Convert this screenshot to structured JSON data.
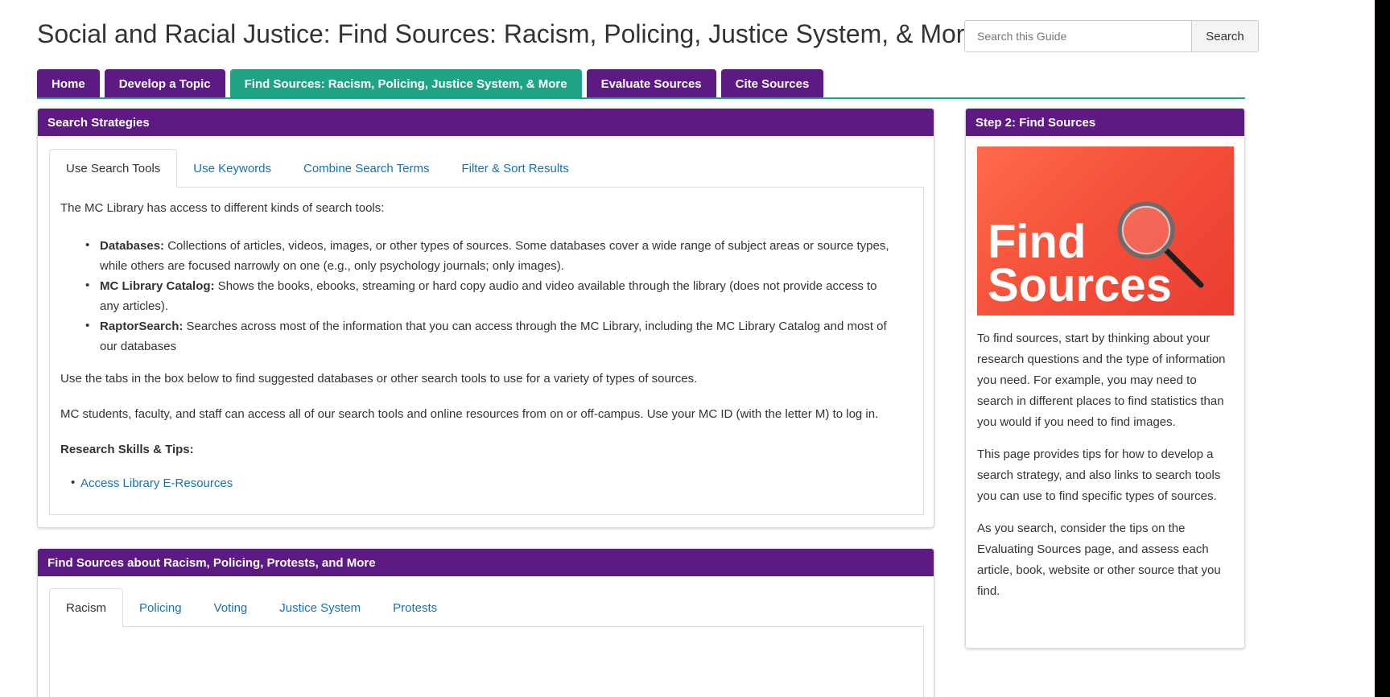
{
  "guide": {
    "title": "Social and Racial Justice: Find Sources: Racism, Policing, Justice System, & More"
  },
  "search": {
    "placeholder": "Search this Guide",
    "button_label": "Search"
  },
  "nav_tabs": [
    {
      "label": "Home"
    },
    {
      "label": "Develop a Topic"
    },
    {
      "label": "Find Sources: Racism, Policing, Justice System, & More"
    },
    {
      "label": "Evaluate Sources"
    },
    {
      "label": "Cite Sources"
    }
  ],
  "colors": {
    "header_purple": "#5c1a82",
    "active_tab_green": "#1fa384",
    "link_blue": "#1572b8",
    "promo_red": "#f4513a"
  },
  "strategies": {
    "header": "Search Strategies",
    "tabs": [
      {
        "label": "Use Search Tools"
      },
      {
        "label": "Use Keywords"
      },
      {
        "label": "Combine Search Terms"
      },
      {
        "label": "Filter & Sort Results"
      }
    ],
    "intro": "The MC Library has access to different kinds of search tools:",
    "bullets": [
      {
        "term": "Databases:",
        "line1": " Collections of articles, videos, images, or other types of sources. Some databases cover a wide range of subject areas or source types,",
        "line2": "while others are focused narrowly on one (e.g., only psychology journals; only images)."
      },
      {
        "term": "MC Library Catalog:",
        "line1": " Shows the books, ebooks, streaming or hard copy audio and video available through the library (does not provide access to",
        "line2": "any articles)."
      },
      {
        "term": "RaptorSearch:",
        "line1": " Searches across most of the information that you can access through the MC Library, including the MC Library Catalog and most of",
        "line2": "our databases"
      }
    ],
    "tabs_note": "Use the tabs in the box below to find suggested databases or other search tools to use for a variety of types of sources.",
    "access_note": "MC students, faculty, and staff  can access all of our search tools and online resources from on or off-campus. Use your MC ID (with the letter M) to log in.",
    "skills_heading": "Research Skills & Tips:",
    "skills_link": "Access Library E-Resources"
  },
  "find_sources": {
    "header": "Find Sources about Racism, Policing, Protests, and More",
    "tabs": [
      {
        "label": "Racism"
      },
      {
        "label": "Policing"
      },
      {
        "label": "Voting"
      },
      {
        "label": "Justice System"
      },
      {
        "label": "Protests"
      }
    ]
  },
  "step2": {
    "header": "Step 2: Find Sources",
    "image_words": [
      "Find",
      "Sources"
    ],
    "p1_lines": [
      "To find sources, start by thinking about your",
      "research questions and the type of information",
      "you need. For example, you may need to",
      "search in different places to find statistics than",
      "you would if you need to find images."
    ],
    "p2_lines": [
      "This page provides tips for how to develop a",
      "search strategy, and also links to search tools",
      "you can use to find specific types of sources."
    ],
    "p3_lines": [
      "As you search, consider the tips on the",
      "Evaluating Sources page, and assess each",
      "article, book, website or other source that you",
      "find."
    ]
  }
}
